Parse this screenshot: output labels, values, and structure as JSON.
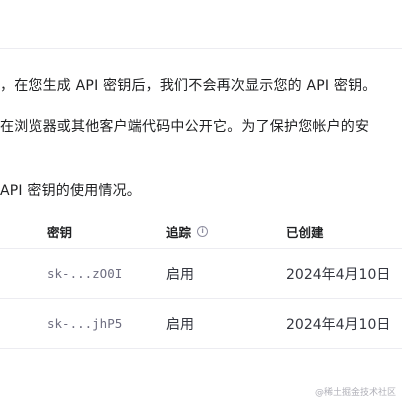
{
  "intro": {
    "line1": "，在您生成 API 密钥后，我们不会再次显示您的 API 密钥。",
    "line2": "在浏览器或其他客户端代码中公开它。为了保护您帐户的安",
    "line3": "API 密钥的使用情况。"
  },
  "table": {
    "headers": {
      "key": "密钥",
      "tracking": "追踪",
      "created": "已创建"
    },
    "rows": [
      {
        "key": "sk-...zO0I",
        "tracking": "启用",
        "created": "2024年4月10日"
      },
      {
        "key": "sk-...jhP5",
        "tracking": "启用",
        "created": "2024年4月10日"
      }
    ]
  },
  "icons": {
    "tracking_info": "info-icon",
    "info_glyph": "i"
  },
  "watermark": "@稀土掘金技术社区"
}
